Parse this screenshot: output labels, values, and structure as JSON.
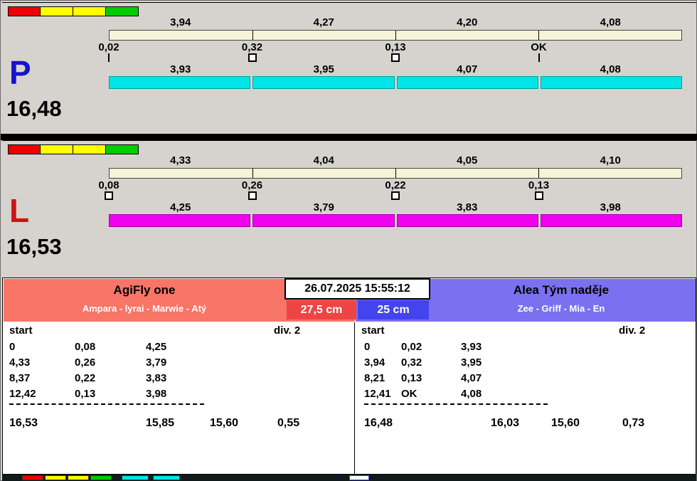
{
  "colors": {
    "lane_p_bar": "#00e6e6",
    "lane_l_bar": "#ef00ef",
    "lane_p_letter": "#1414cc",
    "lane_l_letter": "#cc1414",
    "left_header": "#f87568",
    "right_header": "#7a70f0",
    "left_height_bg": "#ee4444",
    "right_height_bg": "#4444ee",
    "lights": [
      "#ee0000",
      "#ffff00",
      "#ffff00",
      "#00cc00"
    ]
  },
  "lanes": [
    {
      "letter": "P",
      "total": "16,48",
      "top_segments": [
        "3,94",
        "4,27",
        "4,20",
        "4,08"
      ],
      "changes": [
        {
          "label": "0,02",
          "marker": "tick"
        },
        {
          "label": "0,32",
          "marker": "box"
        },
        {
          "label": "0,13",
          "marker": "box"
        },
        {
          "label": "OK",
          "marker": "tick"
        }
      ],
      "bottom_segments": [
        "3,93",
        "3,95",
        "4,07",
        "4,08"
      ]
    },
    {
      "letter": "L",
      "total": "16,53",
      "top_segments": [
        "4,33",
        "4,04",
        "4,05",
        "4,10"
      ],
      "changes": [
        {
          "label": "0,08",
          "marker": "box"
        },
        {
          "label": "0,26",
          "marker": "box"
        },
        {
          "label": "0,22",
          "marker": "box"
        },
        {
          "label": "0,13",
          "marker": "box"
        }
      ],
      "bottom_segments": [
        "4,25",
        "3,79",
        "3,83",
        "3,98"
      ]
    }
  ],
  "footer": {
    "timestamp": "26.07.2025 15:55:12",
    "left": {
      "team": "AgiFly one",
      "members": "Ampara - lyrai - Marwie - Atý",
      "height": "27,5 cm",
      "table": {
        "start_label": "start",
        "div_label": "div.  2",
        "rows": [
          [
            "0",
            "0,08",
            "4,25"
          ],
          [
            "4,33",
            "0,26",
            "3,79"
          ],
          [
            "8,37",
            "0,22",
            "3,83"
          ],
          [
            "12,42",
            "0,13",
            "3,98"
          ]
        ],
        "totals": [
          "16,53",
          "15,85",
          "15,60",
          "0,55"
        ]
      }
    },
    "right": {
      "team": "Alea Tým naděje",
      "members": "Zee - Griff - Mia - En",
      "height": "25 cm",
      "table": {
        "start_label": "start",
        "div_label": "div.  2",
        "rows": [
          [
            "0",
            "0,02",
            "3,93"
          ],
          [
            "3,94",
            "0,32",
            "3,95"
          ],
          [
            "8,21",
            "0,13",
            "4,07"
          ],
          [
            "12,41",
            "OK",
            "4,08"
          ]
        ],
        "totals": [
          "16,48",
          "16,03",
          "15,60",
          "0,73"
        ]
      }
    }
  }
}
